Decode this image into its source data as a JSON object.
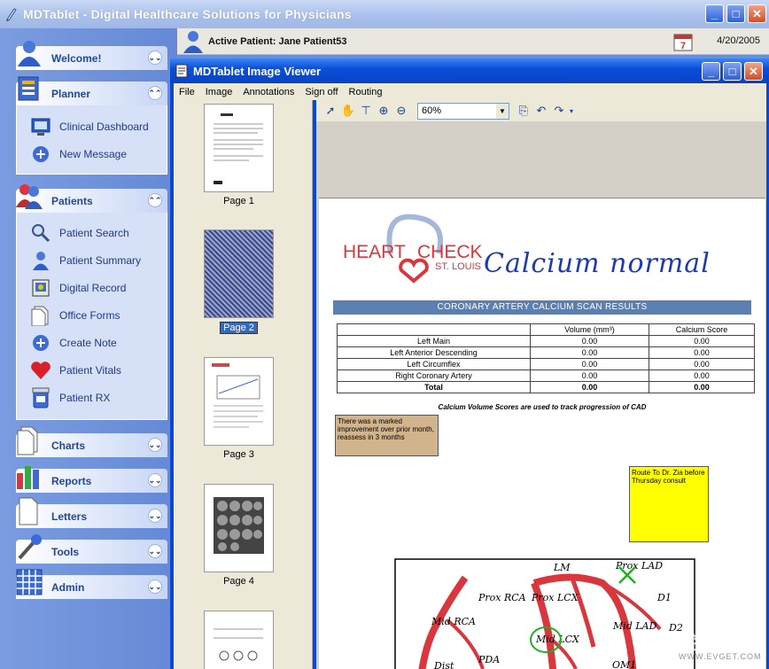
{
  "app": {
    "title": "MDTablet - Digital Healthcare Solutions for Physicians"
  },
  "sidebar": {
    "welcome": {
      "label": "Welcome!"
    },
    "planner": {
      "label": "Planner",
      "items": [
        {
          "label": "Clinical Dashboard",
          "icon": "dashboard-icon"
        },
        {
          "label": "New Message",
          "icon": "message-icon"
        }
      ]
    },
    "patients": {
      "label": "Patients",
      "items": [
        {
          "label": "Patient Search",
          "icon": "search-icon"
        },
        {
          "label": "Patient Summary",
          "icon": "person-icon"
        },
        {
          "label": "Digital Record",
          "icon": "record-icon"
        },
        {
          "label": "Office Forms",
          "icon": "forms-icon"
        },
        {
          "label": "Create Note",
          "icon": "note-icon"
        },
        {
          "label": "Patient Vitals",
          "icon": "heart-icon"
        },
        {
          "label": "Patient RX",
          "icon": "rx-icon"
        }
      ]
    },
    "charts": {
      "label": "Charts"
    },
    "reports": {
      "label": "Reports"
    },
    "letters": {
      "label": "Letters"
    },
    "tools": {
      "label": "Tools"
    },
    "admin": {
      "label": "Admin"
    }
  },
  "patient_bar": {
    "active_patient": "Active Patient: Jane Patient53",
    "date": "4/20/2005",
    "calendar_day": "7"
  },
  "viewer": {
    "title": "MDTablet Image Viewer",
    "menu": [
      "File",
      "Image",
      "Annotations",
      "Sign off",
      "Routing"
    ],
    "zoom": "60%",
    "thumbnails": [
      {
        "label": "Page 1"
      },
      {
        "label": "Page 2"
      },
      {
        "label": "Page 3"
      },
      {
        "label": "Page 4"
      }
    ]
  },
  "document": {
    "logo_heart": "HEART",
    "logo_check": "CHECK",
    "logo_sub": "ST. LOUIS",
    "handwriting": "Calcium normal",
    "banner": "CORONARY ARTERY CALCIUM SCAN RESULTS",
    "table": {
      "headers": [
        "",
        "Volume (mm³)",
        "Calcium Score"
      ],
      "rows": [
        [
          "Left Main",
          "0.00",
          "0.00"
        ],
        [
          "Left Anterior Descending",
          "0.00",
          "0.00"
        ],
        [
          "Left Circumflex",
          "0.00",
          "0.00"
        ],
        [
          "Right Coronary Artery",
          "0.00",
          "0.00"
        ],
        [
          "Total",
          "0.00",
          "0.00"
        ]
      ]
    },
    "caption": "Calcium Volume Scores are used to track progression of CAD",
    "note_brown": "There was a marked improvement over prior month, reassess in 3 months",
    "note_yellow": "Route To Dr. Zia before Thursday consult",
    "diagram_labels": {
      "lm": "LM",
      "prox_lad": "Prox LAD",
      "d1": "D1",
      "prox_rca": "Prox RCA",
      "prox_lcx": "Prox LCX",
      "mid_rca": "Mid RCA",
      "mid_lcx": "Mid LCX",
      "mid_lad": "Mid LAD",
      "d2": "D2",
      "dist": "Dist",
      "pda": "PDA",
      "om1": "OM1"
    }
  },
  "watermark": {
    "text": "WWW.EVGET.COM",
    "cn": "慧都控件网"
  },
  "colors": {
    "sidebar_bg": "#6b8fd6",
    "panel_header_text": "#21469b",
    "viewer_title_bg": "#0a4fd8",
    "logo_red": "#d9363e",
    "note_yellow": "#ffff00",
    "note_brown": "#d2b48c"
  }
}
